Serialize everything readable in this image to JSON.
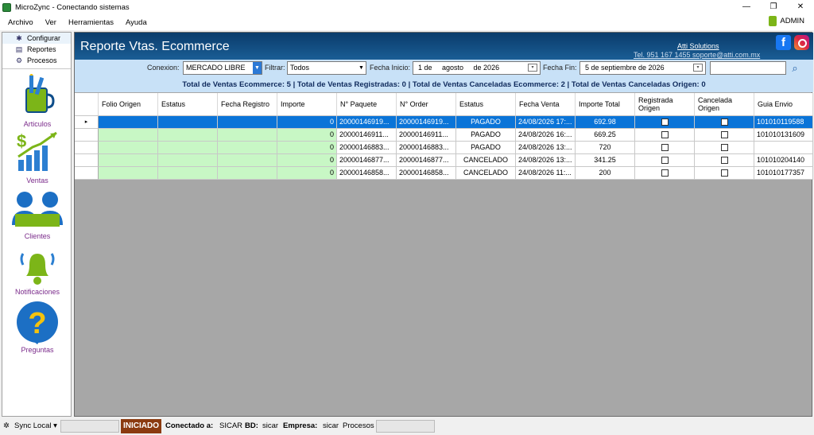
{
  "window": {
    "title": "MicroZync - Conectando sistemas",
    "minimize": "—",
    "restore": "❐",
    "close": "✕"
  },
  "menu": {
    "items": [
      "Archivo",
      "Ver",
      "Herramientas",
      "Ayuda"
    ],
    "user": "ADMIN"
  },
  "sidebar": {
    "menu": [
      "Configurar",
      "Reportes",
      "Procesos"
    ],
    "nav": [
      "Articulos",
      "Ventas",
      "Clientes",
      "Notificaciones",
      "Preguntas"
    ]
  },
  "banner": {
    "title": "Reporte Vtas. Ecommerce",
    "company": "Atti Solutions",
    "contact": "Tel. 951 167 1455  soporte@atti.com.mx"
  },
  "filters": {
    "conexion_label": "Conexion:",
    "conexion_value": "MERCADO LIBRE",
    "filtrar_label": "Filtrar:",
    "filtrar_value": "Todos",
    "fecha_inicio_label": "Fecha Inicio:",
    "fecha_inicio_value": "1 de     agosto     de 2026",
    "fecha_fin_label": "Fecha Fin:",
    "fecha_fin_value": "5 de septiembre de 2026",
    "search_value": ""
  },
  "totals": "Total de Ventas Ecommerce: 5 | Total de Ventas Registradas: 0 | Total de Ventas Canceladas Ecommerce: 2 | Total de Ventas Canceladas Origen: 0",
  "table": {
    "columns": [
      "Folio Origen",
      "Estatus",
      "Fecha Registro",
      "Importe",
      "N° Paquete",
      "N° Order",
      "Estatus",
      "Fecha Venta",
      "Importe Total",
      "Registrada Origen",
      "Cancelada Origen",
      "Guia Envio"
    ],
    "rows": [
      {
        "folio": "",
        "estatus": "",
        "fecha_registro": "",
        "importe": "0",
        "paquete": "20000146919...",
        "order": "20000146919...",
        "estatus_venta": "PAGADO",
        "fecha_venta": "24/08/2026 17:...",
        "importe_total": "692.98",
        "registrada": false,
        "cancelada": false,
        "guia": "101010119588"
      },
      {
        "folio": "",
        "estatus": "",
        "fecha_registro": "",
        "importe": "0",
        "paquete": "20000146911...",
        "order": "20000146911...",
        "estatus_venta": "PAGADO",
        "fecha_venta": "24/08/2026 16:...",
        "importe_total": "669.25",
        "registrada": false,
        "cancelada": false,
        "guia": "101010131609"
      },
      {
        "folio": "",
        "estatus": "",
        "fecha_registro": "",
        "importe": "0",
        "paquete": "20000146883...",
        "order": "20000146883...",
        "estatus_venta": "PAGADO",
        "fecha_venta": "24/08/2026 13:...",
        "importe_total": "720",
        "registrada": false,
        "cancelada": false,
        "guia": ""
      },
      {
        "folio": "",
        "estatus": "",
        "fecha_registro": "",
        "importe": "0",
        "paquete": "20000146877...",
        "order": "20000146877...",
        "estatus_venta": "CANCELADO",
        "fecha_venta": "24/08/2026 13:...",
        "importe_total": "341.25",
        "registrada": false,
        "cancelada": false,
        "guia": "101010204140"
      },
      {
        "folio": "",
        "estatus": "",
        "fecha_registro": "",
        "importe": "0",
        "paquete": "20000146858...",
        "order": "20000146858...",
        "estatus_venta": "CANCELADO",
        "fecha_venta": "24/08/2026 11:...",
        "importe_total": "200",
        "registrada": false,
        "cancelada": false,
        "guia": "101010177357"
      }
    ]
  },
  "status": {
    "sync": "Sync Local",
    "state": "INICIADO",
    "conectado_label": "Conectado a:",
    "conectado_value": "SICAR",
    "bd_label": "BD:",
    "bd_value": "sicar",
    "empresa_label": "Empresa:",
    "empresa_value": "sicar",
    "procesos": "Procesos"
  },
  "colors": {
    "banner": "#0a3c6b",
    "filterbar": "#c8e1f7",
    "row_green": "#c8f7c5",
    "selected": "#0a74d8",
    "nav_text": "#7a2a8a",
    "iniciado": "#8b3a0f"
  }
}
